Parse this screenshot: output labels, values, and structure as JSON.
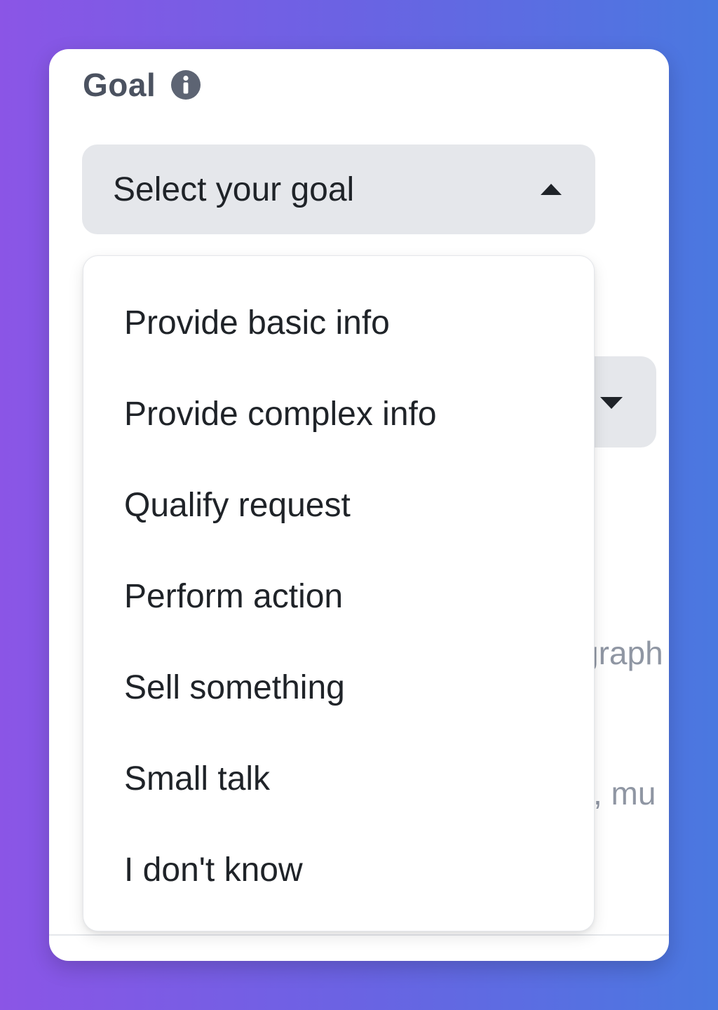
{
  "goal": {
    "label": "Goal",
    "info_icon": "info-icon"
  },
  "select": {
    "placeholder": "Select your goal",
    "icon": "caret-up-icon"
  },
  "dropdown": {
    "options": [
      "Provide basic info",
      "Provide complex info",
      "Qualify request",
      "Perform action",
      "Sell something",
      "Small talk",
      "I don't know"
    ]
  },
  "background": {
    "select_icon": "caret-down-icon",
    "partial_text_1": "graph",
    "partial_text_2": ", mu"
  },
  "colors": {
    "gradient_start": "#8b55e6",
    "gradient_end": "#4a78e0",
    "card": "#ffffff",
    "select_bg": "#e5e7eb",
    "label": "#4b5260",
    "text": "#1f2328",
    "muted_text": "#8f96a3"
  }
}
